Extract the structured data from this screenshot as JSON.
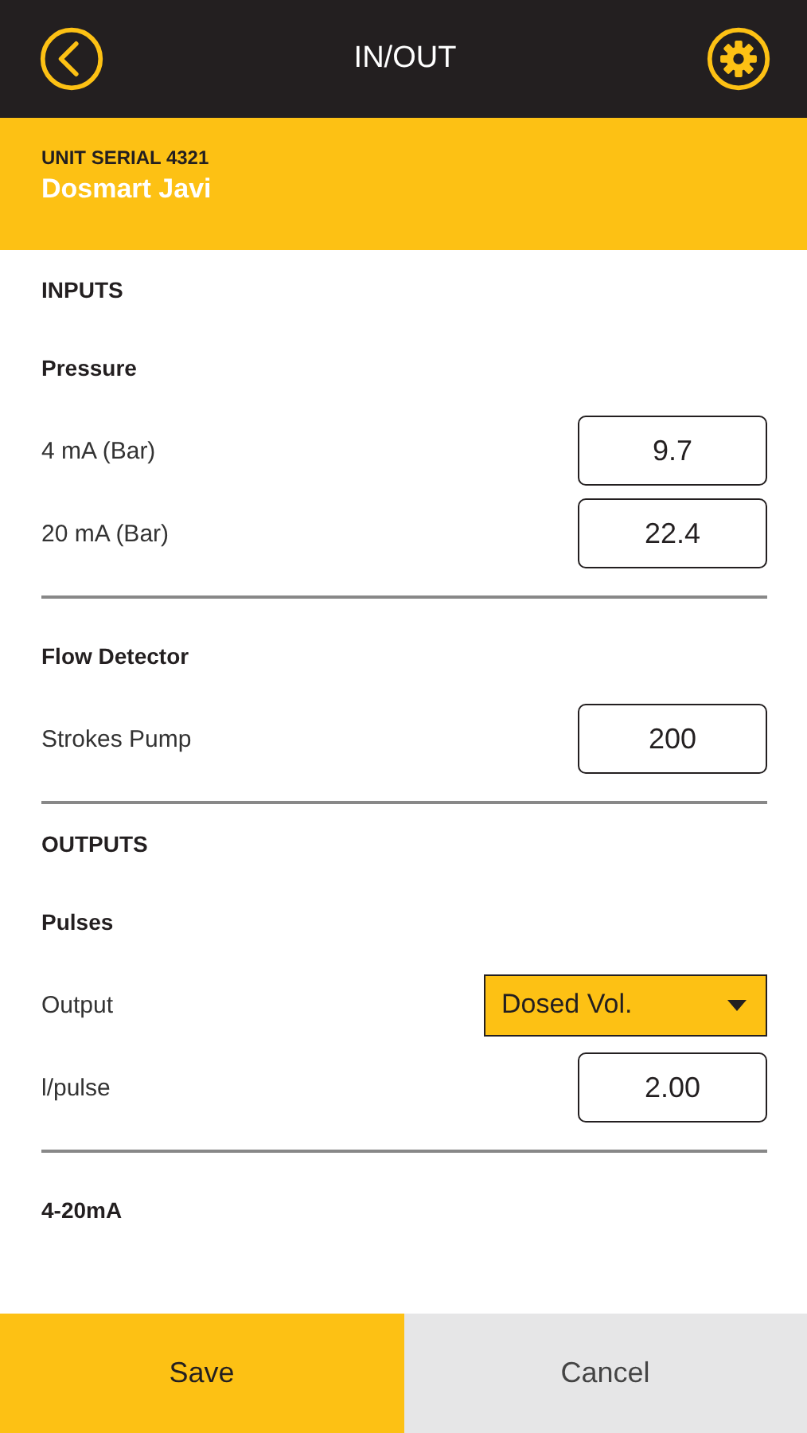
{
  "header": {
    "title": "IN/OUT"
  },
  "unit": {
    "serial": "UNIT SERIAL 4321",
    "name": "Dosmart Javi"
  },
  "sections": [
    {
      "title": "INPUTS",
      "groups": [
        {
          "title": "Pressure",
          "rows": [
            {
              "kind": "number",
              "label": "4 mA (Bar)",
              "value": "9.7"
            },
            {
              "kind": "number",
              "label": "20 mA (Bar)",
              "value": "22.4"
            }
          ]
        },
        {
          "title": "Flow Detector",
          "rows": [
            {
              "kind": "number",
              "label": "Strokes Pump",
              "value": "200"
            }
          ]
        }
      ]
    },
    {
      "title": "OUTPUTS",
      "groups": [
        {
          "title": "Pulses",
          "rows": [
            {
              "kind": "select",
              "label": "Output",
              "value": "Dosed Vol."
            },
            {
              "kind": "number",
              "label": "l/pulse",
              "value": "2.00"
            }
          ]
        },
        {
          "title": "4-20mA"
        }
      ]
    }
  ],
  "buttons": [
    {
      "kind": "primary",
      "label": "Save"
    },
    {
      "kind": "secondary",
      "label": "Cancel"
    }
  ]
}
